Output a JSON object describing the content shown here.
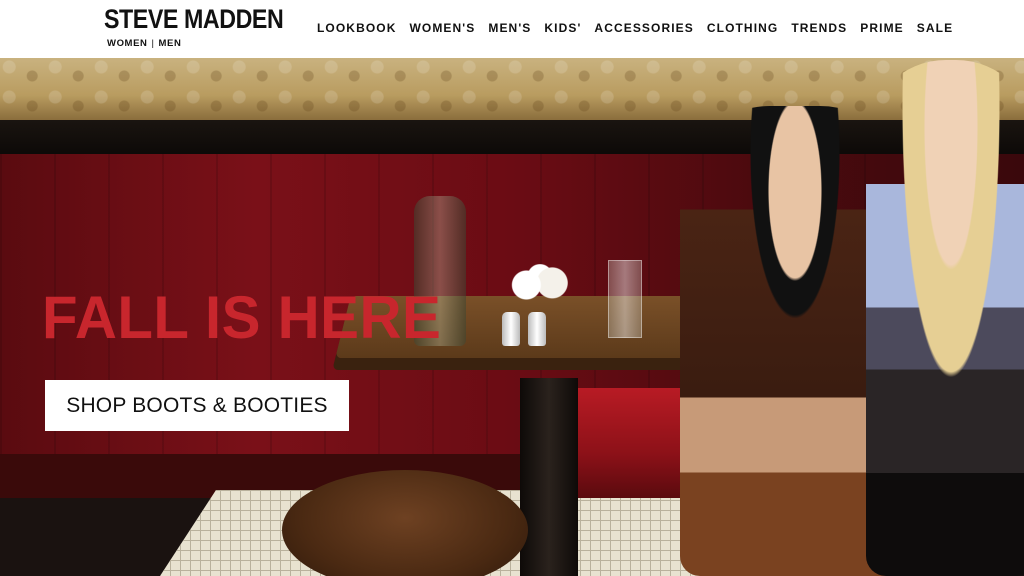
{
  "brand": {
    "name": "STEVE MADDEN",
    "sub_links": [
      "WOMEN",
      "MEN"
    ],
    "sub_separator": "|"
  },
  "nav": {
    "items": [
      "LOOKBOOK",
      "WOMEN'S",
      "MEN'S",
      "KIDS'",
      "ACCESSORIES",
      "CLOTHING",
      "TRENDS",
      "PRIME",
      "SALE"
    ]
  },
  "hero": {
    "headline": "FALL IS HERE",
    "cta_label": "SHOP BOOTS & BOOTIES"
  },
  "colors": {
    "headline": "#c8262d",
    "header_bg": "#ffffff",
    "text": "#111111"
  }
}
